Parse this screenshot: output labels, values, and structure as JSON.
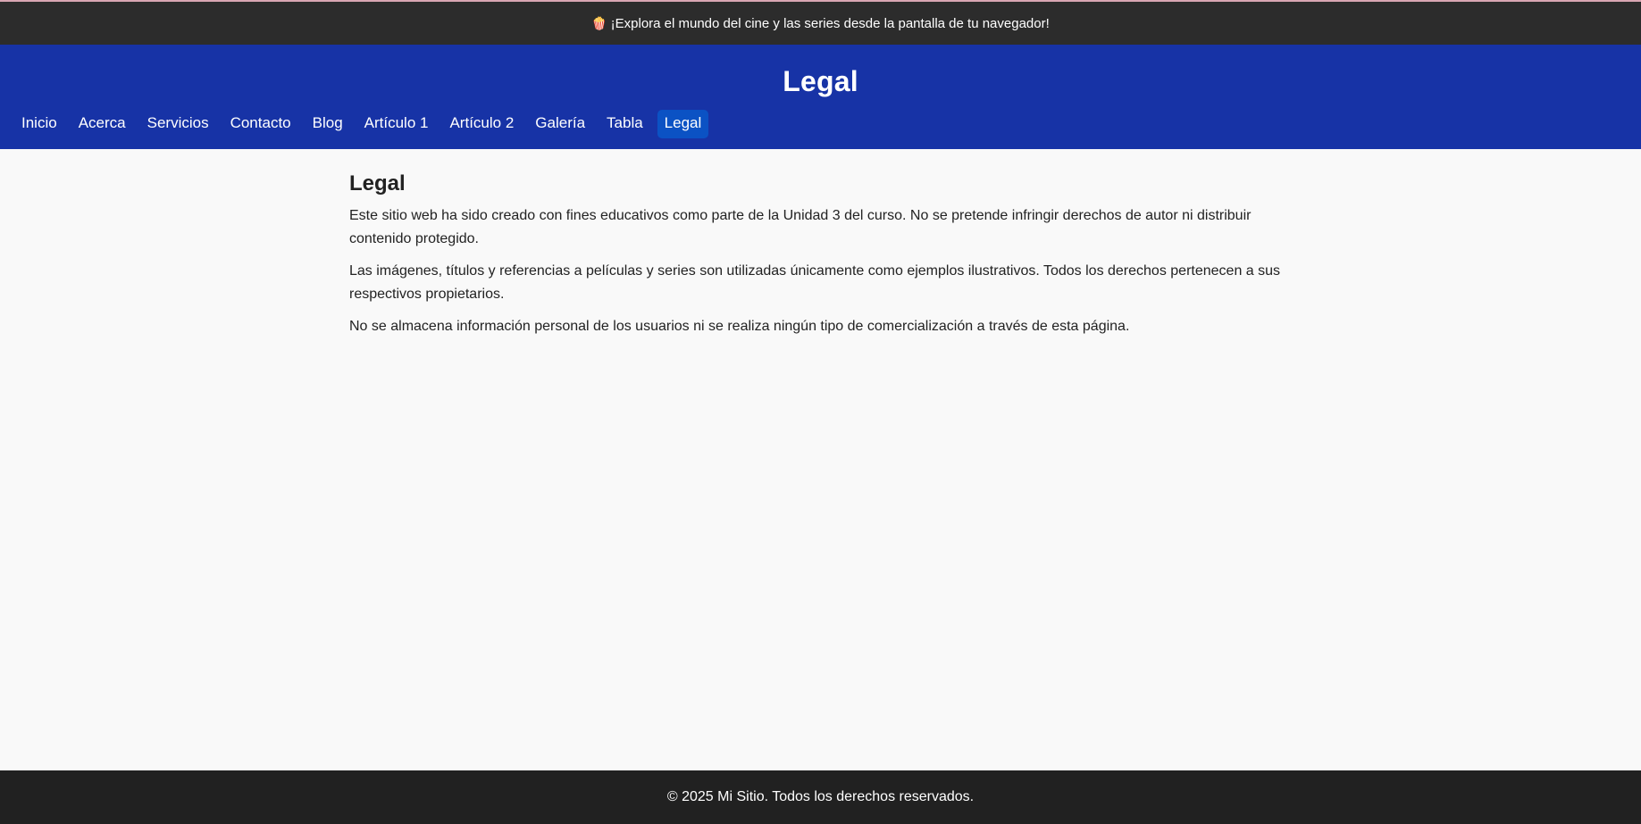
{
  "announcement": {
    "icon": "popcorn-icon",
    "text": "¡Explora el mundo del cine y las series desde la pantalla de tu navegador!"
  },
  "header": {
    "title": "Legal",
    "background": "#1733a6"
  },
  "nav": {
    "items": [
      {
        "label": "Inicio"
      },
      {
        "label": "Acerca"
      },
      {
        "label": "Servicios"
      },
      {
        "label": "Contacto"
      },
      {
        "label": "Blog"
      },
      {
        "label": "Artículo 1"
      },
      {
        "label": "Artículo 2"
      },
      {
        "label": "Galería"
      },
      {
        "label": "Tabla"
      },
      {
        "label": "Legal",
        "active": true
      }
    ],
    "active_color": "#0b52c4"
  },
  "main": {
    "heading": "Legal",
    "paragraphs": [
      "Este sitio web ha sido creado con fines educativos como parte de la Unidad 3 del curso. No se pretende infringir derechos de autor ni distribuir contenido protegido.",
      "Las imágenes, títulos y referencias a películas y series son utilizadas únicamente como ejemplos ilustrativos. Todos los derechos pertenecen a sus respectivos propietarios.",
      "No se almacena información personal de los usuarios ni se realiza ningún tipo de comercialización a través de esta página."
    ]
  },
  "footer": {
    "text": "© 2025 Mi Sitio. Todos los derechos reservados."
  }
}
